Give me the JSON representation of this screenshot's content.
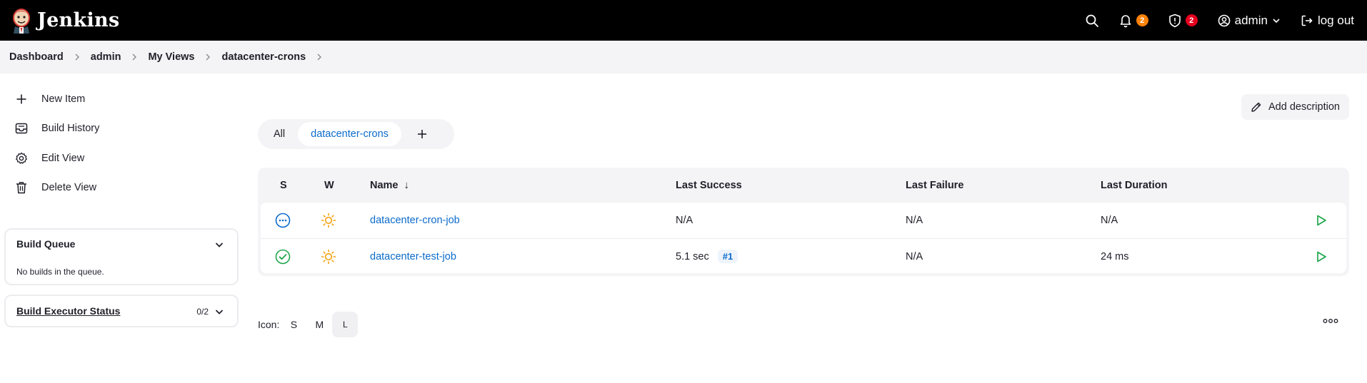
{
  "header": {
    "brand": "Jenkins",
    "notifications_count": "2",
    "security_count": "2",
    "user": "admin",
    "logout": "log out"
  },
  "breadcrumb": [
    "Dashboard",
    "admin",
    "My Views",
    "datacenter-crons"
  ],
  "sidebar": {
    "tasks": [
      "New Item",
      "Build History",
      "Edit View",
      "Delete View"
    ],
    "build_queue": {
      "title": "Build Queue",
      "empty": "No builds in the queue."
    },
    "executor": {
      "title": "Build Executor Status",
      "count": "0/2"
    }
  },
  "add_description": "Add description",
  "tabs": {
    "all": "All",
    "active": "datacenter-crons"
  },
  "table": {
    "headers": {
      "s": "S",
      "w": "W",
      "name": "Name",
      "sort_indicator": "↓",
      "last_success": "Last Success",
      "last_failure": "Last Failure",
      "last_duration": "Last Duration"
    },
    "rows": [
      {
        "name": "datacenter-cron-job",
        "status": "not-built",
        "last_success": "N/A",
        "build": "",
        "last_failure": "N/A",
        "last_duration": "N/A"
      },
      {
        "name": "datacenter-test-job",
        "status": "success",
        "last_success": "5.1 sec",
        "build": "#1",
        "last_failure": "N/A",
        "last_duration": "24 ms"
      }
    ]
  },
  "icon_size": {
    "label": "Icon:",
    "options": [
      "S",
      "M",
      "L"
    ],
    "selected": "L"
  },
  "colors": {
    "header_bg": "#000000",
    "link": "#0b6bcb",
    "success": "#1ea64b",
    "weather": "#f4a10d",
    "badge_orange": "#fe820a",
    "badge_red": "#e6001f"
  }
}
